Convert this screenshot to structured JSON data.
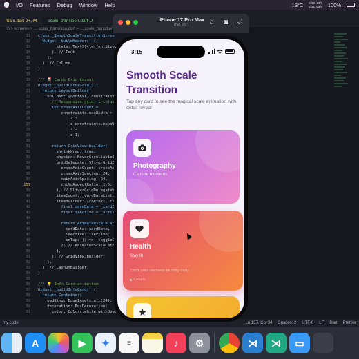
{
  "menubar": {
    "items": [
      "I/O",
      "Features",
      "Debug",
      "Window",
      "Help"
    ],
    "weather": "19°C",
    "network_up": "0.00 KB/s",
    "network_down": "6.31 KB/s",
    "battery": "100%"
  },
  "editor": {
    "tabs": [
      "main.dart 9+, M",
      "scale_transition.dart U"
    ],
    "breadcrumb": "lib > screens > ... scale_transition.dart > ... scale_transition.",
    "lines": [
      {
        "n": "11",
        "t": "  class _SmoothScaleTransitionScreenState"
      },
      {
        "n": "12",
        "t": "    Widget _buildHeader() {"
      },
      {
        "n": "13",
        "t": "          style: TextStyle(fontSize: 1"
      },
      {
        "n": "14",
        "t": "        ), // Text"
      },
      {
        "n": "15",
        "t": "      ],"
      },
      {
        "n": "16",
        "t": "    ); // Column"
      },
      {
        "n": "17",
        "t": "  }"
      },
      {
        "n": "18",
        "t": ""
      },
      {
        "n": "19",
        "t": "  /// 🎴 Cards Grid Layout"
      },
      {
        "n": "20",
        "t": "  Widget _buildCardsGrid() {"
      },
      {
        "n": "21",
        "t": "    return LayoutBuilder("
      },
      {
        "n": "22",
        "t": "      builder: (context, constraints)"
      },
      {
        "n": "23",
        "t": "        // Responsive grid: 1 column o"
      },
      {
        "n": "24",
        "t": "        int crossAxisCount ="
      },
      {
        "n": "25",
        "t": "            constraints.maxWidth > 90"
      },
      {
        "n": "26",
        "t": "                ? 3"
      },
      {
        "n": "27",
        "t": "                : constraints.maxWidt"
      },
      {
        "n": "28",
        "t": "                ? 2"
      },
      {
        "n": "29",
        "t": "                : 1;"
      },
      {
        "n": "30",
        "t": ""
      },
      {
        "n": "31",
        "t": "        return GridView.builder("
      },
      {
        "n": "32",
        "t": "          shrinkWrap: true,"
      },
      {
        "n": "33",
        "t": "          physics: NeverScrollableScr"
      },
      {
        "n": "34",
        "t": "          gridDelegate: SliverGridDele"
      },
      {
        "n": "35",
        "t": "            crossAxisCount: crossAxis"
      },
      {
        "n": "36",
        "t": "            crossAxisSpacing: 24,"
      },
      {
        "n": "37",
        "t": "            mainAxisSpacing: 24,"
      },
      {
        "n": "157",
        "t": "            childAspectRatio: 1.5,"
      },
      {
        "n": "39",
        "t": "          ), // SliverGridDelegateWit"
      },
      {
        "n": "40",
        "t": "          itemCount: _cardDataList.le"
      },
      {
        "n": "41",
        "t": "          itemBuilder: (context, index"
      },
      {
        "n": "42",
        "t": "            final cardData = _cardDat"
      },
      {
        "n": "43",
        "t": "            final isActive = _activeC"
      },
      {
        "n": "44",
        "t": ""
      },
      {
        "n": "45",
        "t": "            return AnimatedScaleCard("
      },
      {
        "n": "46",
        "t": "              cardData: cardData,"
      },
      {
        "n": "47",
        "t": "              isActive: isActive,"
      },
      {
        "n": "48",
        "t": "              onTap: () => _toggleCar"
      },
      {
        "n": "49",
        "t": "            ); // AnimatedScaleCard"
      },
      {
        "n": "50",
        "t": "          },"
      },
      {
        "n": "51",
        "t": "        ); // GridView.builder"
      },
      {
        "n": "52",
        "t": "      },"
      },
      {
        "n": "53",
        "t": "    ); // LayoutBuilder"
      },
      {
        "n": "54",
        "t": "  }"
      },
      {
        "n": "55",
        "t": ""
      },
      {
        "n": "56",
        "t": "  /// 💡 Info Card at bottom"
      },
      {
        "n": "57",
        "t": "  Widget _buildInfoCard() {"
      },
      {
        "n": "58",
        "t": "    return Container("
      },
      {
        "n": "59",
        "t": "      padding: EdgeInsets.all(24),"
      },
      {
        "n": "60",
        "t": "      decoration: BoxDecoration("
      },
      {
        "n": "61",
        "t": "        color: Colors.white.withOpacity("
      }
    ],
    "status_left": "my code",
    "status_right": [
      "Ln 157, Col 34",
      "Spaces: 2",
      "UTF-8",
      "LF",
      "Dart",
      "Prettier"
    ]
  },
  "simulator": {
    "device": "iPhone 17 Pro Max",
    "os": "iOS 26.1",
    "status_time": "3:15"
  },
  "app": {
    "title": "Smooth Scale Transition",
    "subtitle": "Tap any card to see the magical scale animation with detail reveal",
    "cards": [
      {
        "title": "Photography",
        "subtitle": "Capture moments",
        "icon": "camera-icon",
        "gradient_start": "#b56bf0",
        "gradient_end": "#f08bc8"
      },
      {
        "title": "Health",
        "subtitle": "Stay fit",
        "description": "Track your wellness journey daily",
        "footer": "Details",
        "icon": "heart-icon",
        "gradient_start": "#e44c78",
        "gradient_end": "#f58a3e"
      },
      {
        "title": "",
        "subtitle": "",
        "icon": "star-icon",
        "gradient_start": "#f6c431",
        "gradient_end": "#f2a92e"
      }
    ]
  },
  "dock": {
    "icons": [
      "finder-icon",
      "app-store-icon",
      "photos-icon",
      "facetime-icon",
      "safari-icon",
      "reminders-icon",
      "notes-icon",
      "music-icon",
      "system-settings-icon",
      "chrome-icon",
      "vscode-icon",
      "vscode-insiders-icon",
      "simulator-icon",
      "tv-icon"
    ]
  }
}
